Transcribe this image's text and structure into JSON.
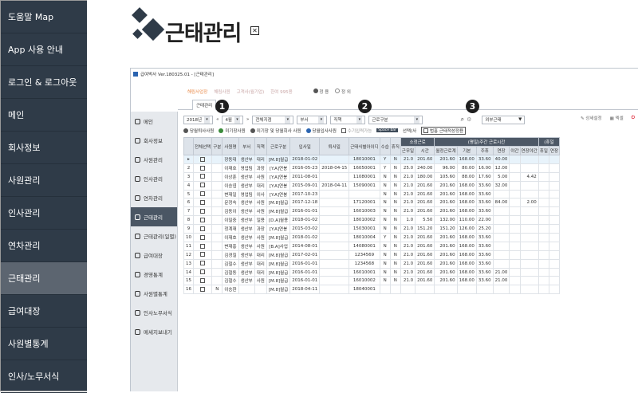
{
  "sidebar": {
    "items": [
      {
        "label": "도움말 Map"
      },
      {
        "label": "App 사용 안내"
      },
      {
        "label": "로그인 & 로그아웃"
      },
      {
        "label": "메인"
      },
      {
        "label": "회사정보"
      },
      {
        "label": "사원관리"
      },
      {
        "label": "인사관리"
      },
      {
        "label": "연차관리"
      },
      {
        "label": "근태관리",
        "active": true
      },
      {
        "label": "급여대장"
      },
      {
        "label": "사원별통계"
      },
      {
        "label": "인사/노무서식"
      }
    ]
  },
  "page": {
    "title": "근태관리",
    "close_icon": "close-icon"
  },
  "app_window": {
    "title": "급여박사 Ver.180325.01 - [근태관리]",
    "company": {
      "label": "해림사업장",
      "items": [
        "해림사원",
        "고객사(월기업)",
        "한여 995용"
      ],
      "radio_on": "정 용",
      "radio_off": "정 외"
    },
    "tab": "근태관리",
    "nav": [
      "메인",
      "회사정보",
      "사원관리",
      "인사관리",
      "연차관리",
      "근태관리",
      "근태관리(일별)",
      "급여대장",
      "경영통계",
      "사원별통계",
      "인사노무서식",
      "메세지보내기"
    ],
    "nav_active": "근태관리",
    "toolbar": {
      "year": "2018년",
      "month": "4월",
      "workplace": "전체지점",
      "dept": "부서",
      "position": "직책",
      "worktype": "근로구분",
      "extra": "외부근태",
      "right": [
        "상세설정",
        "엑셀"
      ]
    },
    "filters": {
      "f1": "당월퇴사사원",
      "f2": "미기장사원",
      "f3": "미기장 및 당월회사 사원",
      "f4": "당월입사사원",
      "f5": "수기입력가능",
      "space": "Space bar",
      "select": "선택(사",
      "bulk": "법홍 근태적성정용"
    },
    "markers": [
      "1",
      "2",
      "3"
    ]
  },
  "grid": {
    "headers": [
      "",
      "전체선택",
      "구분",
      "사원명",
      "부서",
      "직책",
      "근로구분",
      "입사일",
      "퇴사일",
      "근태식별아이디",
      "수습",
      "휴직",
      "근무일",
      "시간",
      "월정근로계",
      "기본",
      "주휴",
      "연장",
      "야간",
      "연장야간",
      "휴일",
      "연장"
    ],
    "group_headers": {
      "scheduled": "소정근로",
      "weekly": "(평일)주간 근로시간",
      "holiday": "(휴일"
    },
    "rows": [
      [
        "▸",
        "",
        "",
        "장동대",
        "생산부",
        "대리",
        "[M.8]월급",
        "2018-01-02",
        "",
        "18010001",
        "Y",
        "N",
        "21.0",
        "201.60",
        "201.60",
        "168.00",
        "33.60",
        "40.00",
        "",
        "",
        "",
        ""
      ],
      [
        "2",
        "",
        "",
        "이재호",
        "영업팀",
        "과장",
        "[Y.A]연봉",
        "2016-05-23",
        "2018-04-15",
        "16050001",
        "Y",
        "N",
        "25.0",
        "240.00",
        "96.00",
        "80.00",
        "16.00",
        "12.00",
        "",
        "",
        "",
        ""
      ],
      [
        "3",
        "",
        "",
        "이상훈",
        "생산부",
        "사원",
        "[Y.A]연봉",
        "2011-08-01",
        "",
        "11080001",
        "N",
        "N",
        "21.0",
        "180.00",
        "105.60",
        "88.00",
        "17.60",
        "5.00",
        "",
        "4.42",
        "",
        ""
      ],
      [
        "4",
        "",
        "",
        "이승엽",
        "생산부",
        "대리",
        "[Y.A]연봉",
        "2015-09-01",
        "2018-04-11",
        "15090001",
        "N",
        "N",
        "21.0",
        "201.60",
        "201.60",
        "168.00",
        "33.60",
        "32.00",
        "",
        "",
        "",
        ""
      ],
      [
        "5",
        "",
        "",
        "변재일",
        "영업팀",
        "이사",
        "[Y.A]연봉",
        "2017-10-23",
        "",
        "",
        "N",
        "N",
        "21.0",
        "201.60",
        "201.60",
        "168.00",
        "33.60",
        "",
        "",
        "",
        "",
        ""
      ],
      [
        "6",
        "",
        "",
        "문정숙",
        "생산부",
        "사원",
        "[M.8]월급",
        "2017-12-18",
        "",
        "17120001",
        "N",
        "N",
        "21.0",
        "201.60",
        "201.60",
        "168.00",
        "33.60",
        "84.00",
        "",
        "2.00",
        "",
        ""
      ],
      [
        "7",
        "",
        "",
        "김동이",
        "생산부",
        "사원",
        "[M.8]월급",
        "2016-01-01",
        "",
        "16010003",
        "N",
        "N",
        "21.0",
        "201.60",
        "201.60",
        "168.00",
        "33.60",
        "",
        "",
        "",
        "",
        ""
      ],
      [
        "8",
        "",
        "",
        "이밀중",
        "생산부",
        "일용",
        "[D.A]월용",
        "2018-01-02",
        "",
        "18010002",
        "N",
        "N",
        "1.0",
        "5.50",
        "132.00",
        "110.00",
        "22.00",
        "",
        "",
        "",
        "",
        ""
      ],
      [
        "9",
        "",
        "",
        "정계재",
        "생산부",
        "과장",
        "[Y.A]연봉",
        "2015-03-02",
        "",
        "15030001",
        "N",
        "N",
        "21.0",
        "151.20",
        "151.20",
        "126.00",
        "25.20",
        "",
        "",
        "",
        "",
        ""
      ],
      [
        "10",
        "",
        "",
        "이재호",
        "생산부",
        "사원",
        "[M.8]월급",
        "2018-01-02",
        "",
        "18010004",
        "Y",
        "N",
        "21.0",
        "201.60",
        "201.60",
        "168.00",
        "33.60",
        "",
        "",
        "",
        "",
        ""
      ],
      [
        "11",
        "",
        "",
        "변재홍",
        "생산부",
        "사원",
        "[B.A]사업",
        "2014-08-01",
        "",
        "14080001",
        "N",
        "N",
        "21.0",
        "201.60",
        "201.60",
        "168.00",
        "33.60",
        "",
        "",
        "",
        "",
        ""
      ],
      [
        "12",
        "",
        "",
        "김경칠",
        "생산부",
        "대리",
        "[M.8]월급",
        "2017-02-01",
        "",
        "1234569",
        "N",
        "N",
        "21.0",
        "201.60",
        "201.60",
        "168.00",
        "33.60",
        "",
        "",
        "",
        "",
        ""
      ],
      [
        "13",
        "",
        "",
        "김철수",
        "생산부",
        "대리",
        "[M.8]월급",
        "2016-01-01",
        "",
        "1234568",
        "N",
        "N",
        "21.0",
        "201.60",
        "201.60",
        "168.00",
        "33.60",
        "",
        "",
        "",
        "",
        ""
      ],
      [
        "14",
        "",
        "",
        "김철동",
        "생산부",
        "대리",
        "[M.8]월급",
        "2016-01-01",
        "",
        "16010001",
        "N",
        "N",
        "21.0",
        "201.60",
        "201.60",
        "168.00",
        "33.60",
        "21.00",
        "",
        "",
        "",
        ""
      ],
      [
        "15",
        "",
        "",
        "김철수",
        "생산부",
        "사원",
        "[M.8]월급",
        "2016-01-01",
        "",
        "16010002",
        "N",
        "N",
        "21.0",
        "201.60",
        "201.60",
        "168.00",
        "33.60",
        "21.00",
        "",
        "",
        "",
        ""
      ],
      [
        "16",
        "",
        "N",
        "이승환",
        "",
        "",
        "[M.8]월급",
        "2018-04-11",
        "",
        "18040001",
        "",
        "",
        "",
        "",
        "",
        "",
        "",
        "",
        "",
        "",
        "",
        ""
      ]
    ]
  }
}
